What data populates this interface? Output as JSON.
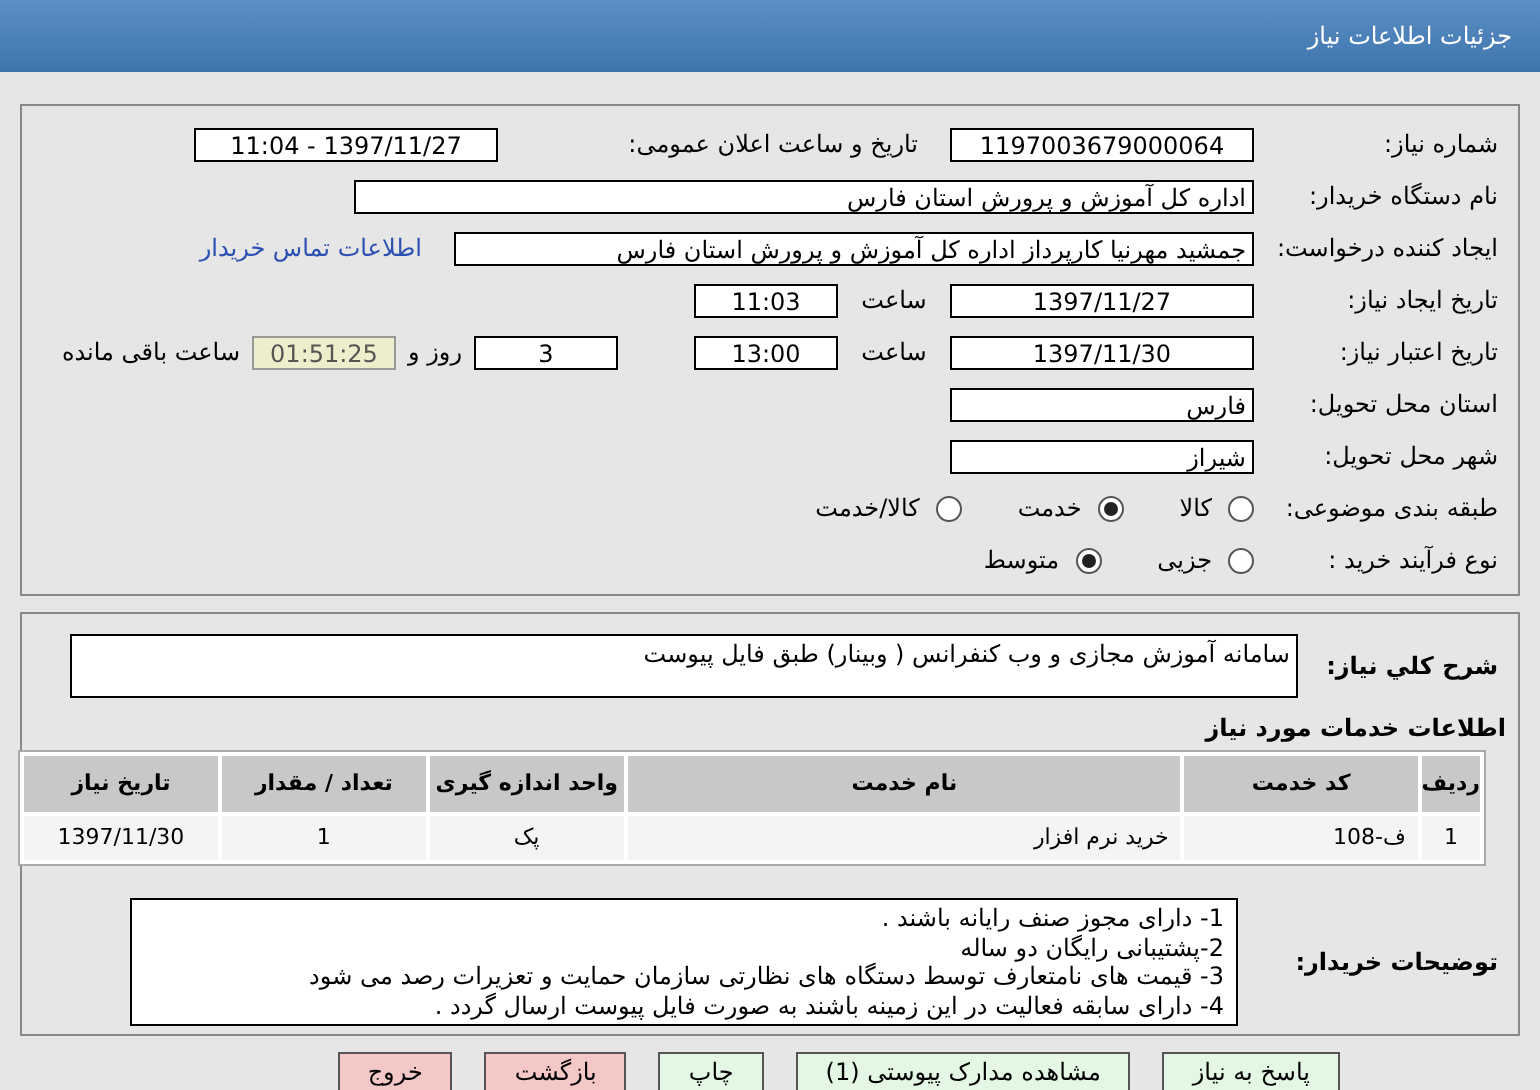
{
  "header": {
    "title": "جزئیات اطلاعات نیاز"
  },
  "details": {
    "need_number": {
      "label": "شماره نیاز:",
      "value": "1197003679000064"
    },
    "announce": {
      "label": "تاریخ و ساعت اعلان عمومی:",
      "value": "1397/11/27 - 11:04"
    },
    "buyer": {
      "label": "نام دستگاه خریدار:",
      "value": "اداره کل آموزش و پرورش استان فارس"
    },
    "creator": {
      "label": "ایجاد کننده درخواست:",
      "value": "جمشید مهرنیا کارپرداز اداره کل آموزش و پرورش استان فارس",
      "link": "اطلاعات تماس خریدار"
    },
    "created": {
      "label": "تاریخ ایجاد نیاز:",
      "date": "1397/11/27",
      "time_label": "ساعت",
      "time": "11:03"
    },
    "validity": {
      "label": "تاریخ اعتبار نیاز:",
      "date": "1397/11/30",
      "time_label": "ساعت",
      "time": "13:00",
      "days": "3",
      "days_label": "روز و",
      "remaining": "01:51:25",
      "remaining_label": "ساعت باقی مانده"
    },
    "province": {
      "label": "استان محل تحویل:",
      "value": "فارس"
    },
    "city": {
      "label": "شهر محل تحویل:",
      "value": "شیراز"
    },
    "category": {
      "label": "طبقه بندی موضوعی:",
      "options": [
        {
          "label": "کالا",
          "selected": false
        },
        {
          "label": "خدمت",
          "selected": true
        },
        {
          "label": "کالا/خدمت",
          "selected": false
        }
      ]
    },
    "process": {
      "label": "نوع فرآیند خرید :",
      "options": [
        {
          "label": "جزیی",
          "selected": false
        },
        {
          "label": "متوسط",
          "selected": true
        }
      ]
    }
  },
  "summary": {
    "label": "شرح کلي نیاز:",
    "value": "سامانه آموزش مجازی و وب کنفرانس ( وبینار) طبق فایل پیوست"
  },
  "services": {
    "title": "اطلاعات خدمات مورد نیاز",
    "columns": [
      "ردیف",
      "کد خدمت",
      "نام خدمت",
      "واحد اندازه گیری",
      "تعداد / مقدار",
      "تاریخ نیاز"
    ],
    "rows": [
      [
        "1",
        "ف-108",
        "خرید نرم افزار",
        "پک",
        "1",
        "1397/11/30"
      ]
    ]
  },
  "notes": {
    "label": "توضیحات خریدار:",
    "lines": [
      "1- دارای مجوز صنف رایانه باشند .",
      "2-پشتیبانی رایگان دو ساله",
      "3- قیمت های نامتعارف توسط دستگاه های نظارتی سازمان حمایت و تعزیرات رصد می شود",
      "4- دارای سابقه فعالیت در این زمینه باشند به صورت فایل پیوست ارسال گردد ."
    ]
  },
  "buttons": [
    {
      "label": "پاسخ به نیاز",
      "kind": "action"
    },
    {
      "label": "مشاهده مدارک پیوستی (1)",
      "kind": "action"
    },
    {
      "label": "چاپ",
      "kind": "action"
    },
    {
      "label": "بازگشت",
      "kind": "danger"
    },
    {
      "label": "خروج",
      "kind": "danger"
    }
  ]
}
